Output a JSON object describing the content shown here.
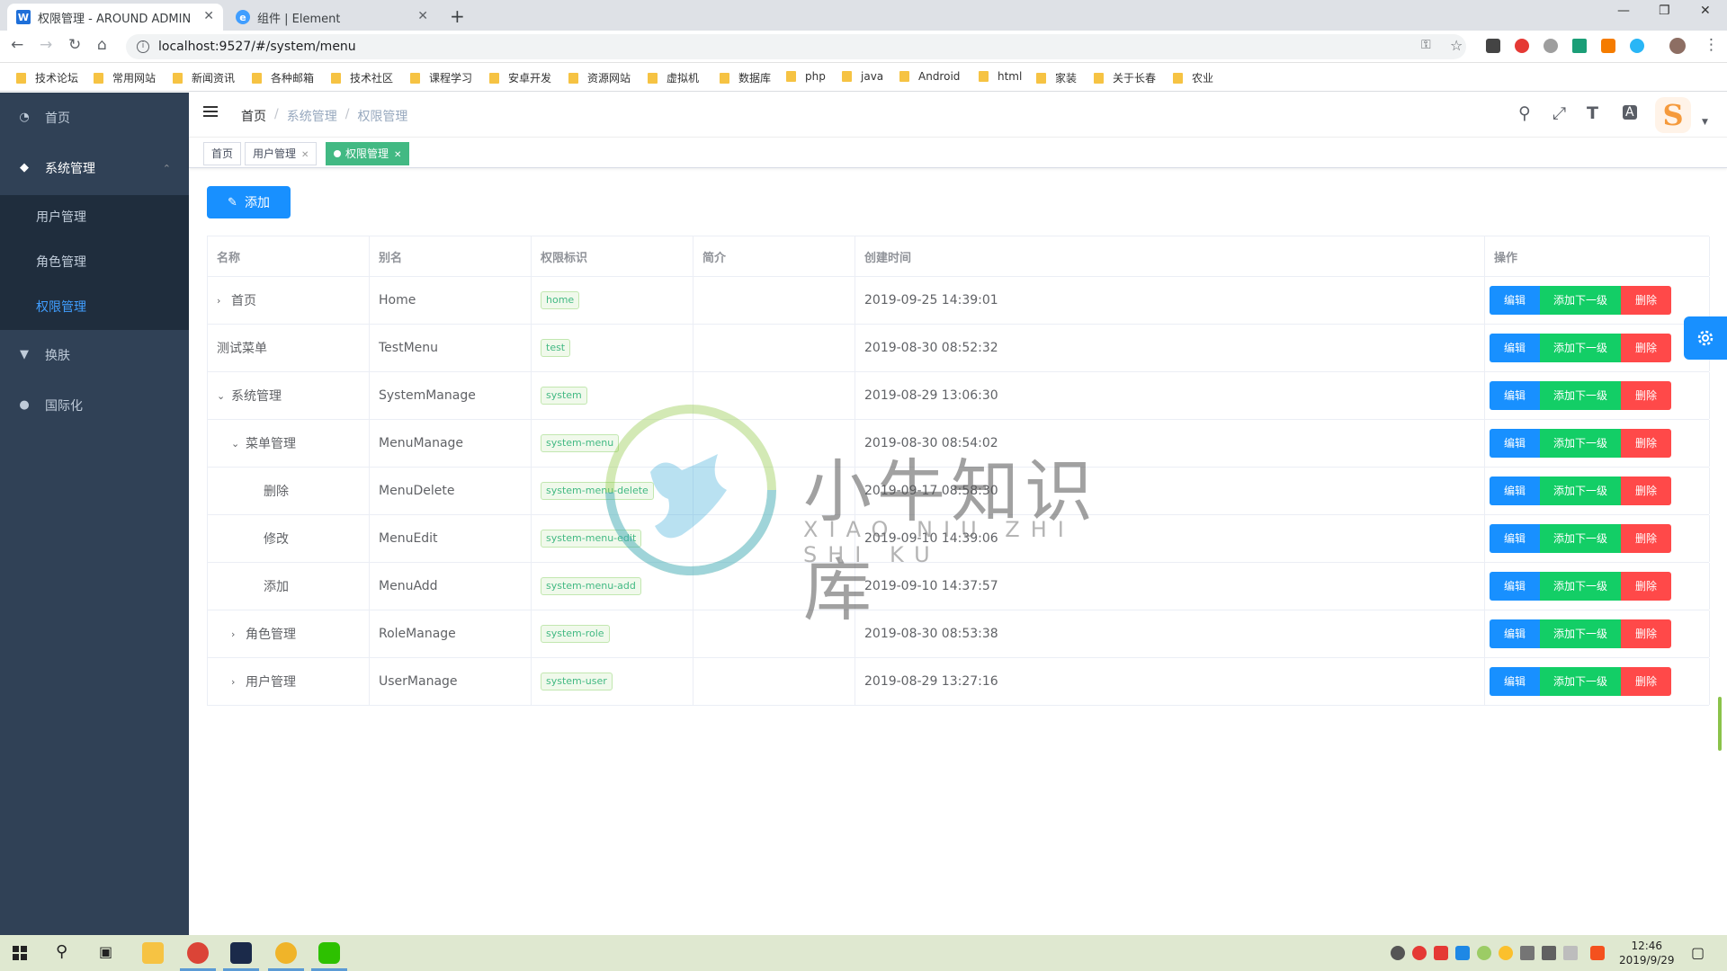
{
  "browser": {
    "tabs": [
      {
        "title": "权限管理 - AROUND ADMIN",
        "favicon": "W",
        "favicon_color": "#1e6fd9"
      },
      {
        "title": "组件 | Element",
        "favicon": "e",
        "favicon_color": "#409eff"
      }
    ],
    "url": "localhost:9527/#/system/menu",
    "bookmarks": [
      "技术论坛",
      "常用网站",
      "新闻资讯",
      "各种邮箱",
      "技术社区",
      "课程学习",
      "安卓开发",
      "资源网站",
      "虚拟机",
      "数据库",
      "php",
      "java",
      "Android",
      "html",
      "家装",
      "关于长春",
      "农业"
    ]
  },
  "sidebar": {
    "items": [
      {
        "label": "首页",
        "icon": "dashboard-icon"
      },
      {
        "label": "系统管理",
        "icon": "cube-icon",
        "open": true
      },
      {
        "label": "换肤",
        "icon": "shirt-icon"
      },
      {
        "label": "国际化",
        "icon": "globe-icon"
      }
    ],
    "submenu": [
      {
        "label": "用户管理"
      },
      {
        "label": "角色管理"
      },
      {
        "label": "权限管理",
        "active": true
      }
    ]
  },
  "navbar": {
    "breadcrumb": [
      "首页",
      "系统管理",
      "权限管理"
    ],
    "icons": [
      "search-icon",
      "fullscreen-icon",
      "font-size-icon",
      "translate-icon"
    ],
    "avatar_letter": "S"
  },
  "tags": [
    {
      "label": "首页",
      "closable": false
    },
    {
      "label": "用户管理",
      "closable": true
    },
    {
      "label": "权限管理",
      "closable": true,
      "active": true
    }
  ],
  "toolbar": {
    "add_label": "添加"
  },
  "table": {
    "headers": [
      "名称",
      "别名",
      "权限标识",
      "简介",
      "创建时间",
      "操作"
    ],
    "rows": [
      {
        "name": "首页",
        "alias": "Home",
        "perm": "home",
        "desc": "",
        "created": "2019-09-25 14:39:01",
        "level": 0,
        "expander": "›"
      },
      {
        "name": "测试菜单",
        "alias": "TestMenu",
        "perm": "test",
        "desc": "",
        "created": "2019-08-30 08:52:32",
        "level": 0,
        "expander": ""
      },
      {
        "name": "系统管理",
        "alias": "SystemManage",
        "perm": "system",
        "desc": "",
        "created": "2019-08-29 13:06:30",
        "level": 0,
        "expander": "⌄"
      },
      {
        "name": "菜单管理",
        "alias": "MenuManage",
        "perm": "system-menu",
        "desc": "",
        "created": "2019-08-30 08:54:02",
        "level": 1,
        "expander": "⌄"
      },
      {
        "name": "删除",
        "alias": "MenuDelete",
        "perm": "system-menu-delete",
        "desc": "",
        "created": "2019-09-17 08:58:30",
        "level": 2,
        "expander": ""
      },
      {
        "name": "修改",
        "alias": "MenuEdit",
        "perm": "system-menu-edit",
        "desc": "",
        "created": "2019-09-10 14:39:06",
        "level": 2,
        "expander": ""
      },
      {
        "name": "添加",
        "alias": "MenuAdd",
        "perm": "system-menu-add",
        "desc": "",
        "created": "2019-09-10 14:37:57",
        "level": 2,
        "expander": ""
      },
      {
        "name": "角色管理",
        "alias": "RoleManage",
        "perm": "system-role",
        "desc": "",
        "created": "2019-08-30 08:53:38",
        "level": 1,
        "expander": "›"
      },
      {
        "name": "用户管理",
        "alias": "UserManage",
        "perm": "system-user",
        "desc": "",
        "created": "2019-08-29 13:27:16",
        "level": 1,
        "expander": "›"
      }
    ],
    "op_labels": {
      "edit": "编辑",
      "add_child": "添加下一级",
      "delete": "删除"
    }
  },
  "watermark": {
    "title": "小牛知识库",
    "subtitle": "XIAO NIU ZHI SHI KU"
  },
  "taskbar": {
    "time": "12:46",
    "date": "2019/9/29"
  },
  "colors": {
    "sidebar_bg": "#304156",
    "active": "#409eff",
    "tag_active": "#42b983",
    "primary": "#1890ff",
    "success": "#13ce66",
    "danger": "#ff4949"
  }
}
